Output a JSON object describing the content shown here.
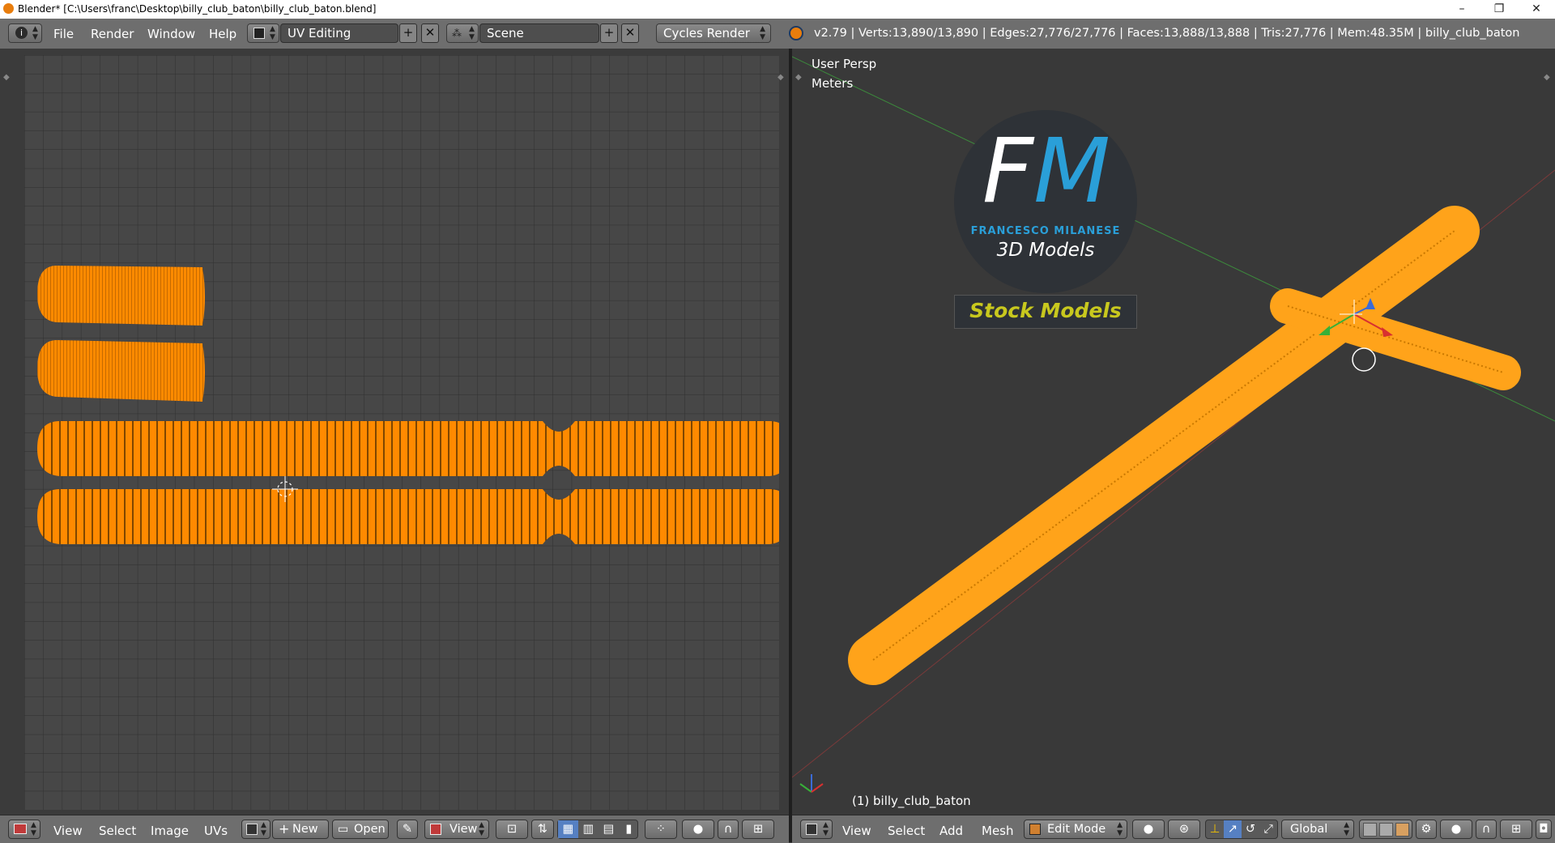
{
  "window": {
    "title": "Blender* [C:\\Users\\franc\\Desktop\\billy_club_baton\\billy_club_baton.blend]",
    "controls": [
      "–",
      "❐",
      "✕"
    ]
  },
  "info_header": {
    "menus": [
      "File",
      "Render",
      "Window",
      "Help"
    ],
    "screen_layout": "UV Editing",
    "scene": "Scene",
    "render_engine": "Cycles Render",
    "stats": "v2.79 | Verts:13,890/13,890 | Edges:27,776/27,776 | Faces:13,888/13,888 | Tris:27,776 | Mem:48.35M | billy_club_baton"
  },
  "uv_editor": {
    "menus": [
      "View",
      "Select",
      "Image",
      "UVs"
    ],
    "new_label": "New",
    "open_label": "Open",
    "view_label": "View",
    "uv_color": "#ff8a00"
  },
  "viewport": {
    "view_name": "User Persp",
    "units": "Meters",
    "object_label": "(1) billy_club_baton",
    "menus": [
      "View",
      "Select",
      "Add",
      "Mesh"
    ],
    "mode": "Edit Mode",
    "orientation": "Global",
    "mesh_color": "#ffa31a"
  },
  "watermark": {
    "logo_letters": "FM",
    "brand": "FRANCESCO MILANESE",
    "subtitle": "3D Models",
    "tagline": "Stock Models"
  },
  "colors": {
    "header_bg": "#6e6e6e",
    "editor_bg": "#3b3b3b",
    "accent_orange": "#ff8a00",
    "selection_blue": "#5680c2"
  }
}
